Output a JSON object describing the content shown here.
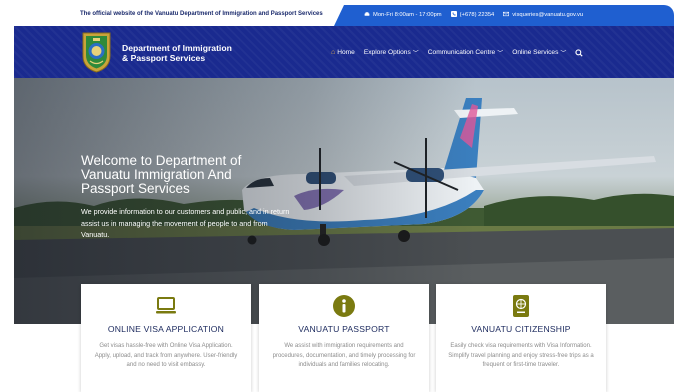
{
  "topbar": {
    "official_text": "The official website of the Vanuatu Department of Immigration and Passport Services",
    "hours": "Mon-Fri 8:00am - 17:00pm",
    "phone": "(+678) 22354",
    "email": "visqueries@vanuatu.gov.vu"
  },
  "header": {
    "brand_line1": "Department of Immigration",
    "brand_line2": "& Passport Services",
    "nav": {
      "home": "Home",
      "explore": "Explore Options",
      "communication": "Communication Centre",
      "online": "Online Services"
    }
  },
  "hero": {
    "title": "Welcome to Department of Vanuatu Immigration And Passport Services",
    "text": "We provide information to our customers and public, and in return assist us in managing the movement of people to and from Vanuatu."
  },
  "cards": [
    {
      "title": "ONLINE VISA APPLICATION",
      "text": "Get visas hassle-free with Online Visa Application. Apply, upload, and track from anywhere. User-friendly and no need to visit embassy.",
      "icon": "laptop-icon"
    },
    {
      "title": "VANUATU PASSPORT",
      "text": "We assist with immigration requirements and procedures, documentation, and timely processing for individuals and families relocating.",
      "icon": "info-icon"
    },
    {
      "title": "VANUATU CITIZENSHIP",
      "text": "Easily check visa requirements with Visa Information. Simplify travel planning and enjoy stress-free trips as a frequent or first-time traveler.",
      "icon": "passport-icon"
    }
  ],
  "colors": {
    "header_blue": "#1a2a8f",
    "topbar_blue": "#1f5fd0",
    "icon_olive": "#7a7a10",
    "card_title": "#1c2a5e"
  }
}
